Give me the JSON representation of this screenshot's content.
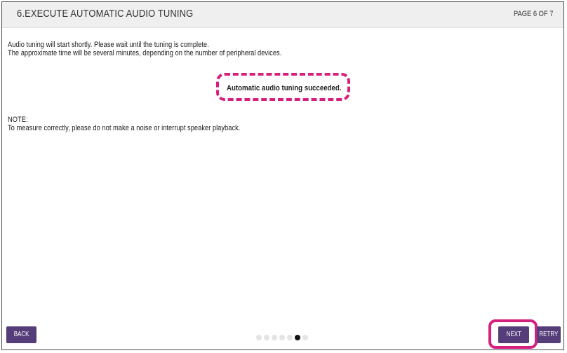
{
  "header": {
    "title": "6.EXECUTE AUTOMATIC AUDIO TUNING",
    "page_indicator": "PAGE 6 OF 7"
  },
  "body": {
    "intro_line1": "Audio tuning will start shortly. Please wait until the tuning is complete.",
    "intro_line2": "The approximate time will be several minutes, depending on the number of peripheral devices.",
    "status_message": "Automatic audio tuning succeeded.",
    "note_label": "NOTE:",
    "note_text": "To measure correctly, please do not make a noise or interrupt speaker playback."
  },
  "footer": {
    "back_label": "BACK",
    "next_label": "NEXT",
    "retry_label": "RETRY",
    "pagination": {
      "total": 7,
      "current": 6
    }
  },
  "colors": {
    "button": "#553d7a",
    "highlight": "#d6207f",
    "header_bg": "#efefef"
  }
}
